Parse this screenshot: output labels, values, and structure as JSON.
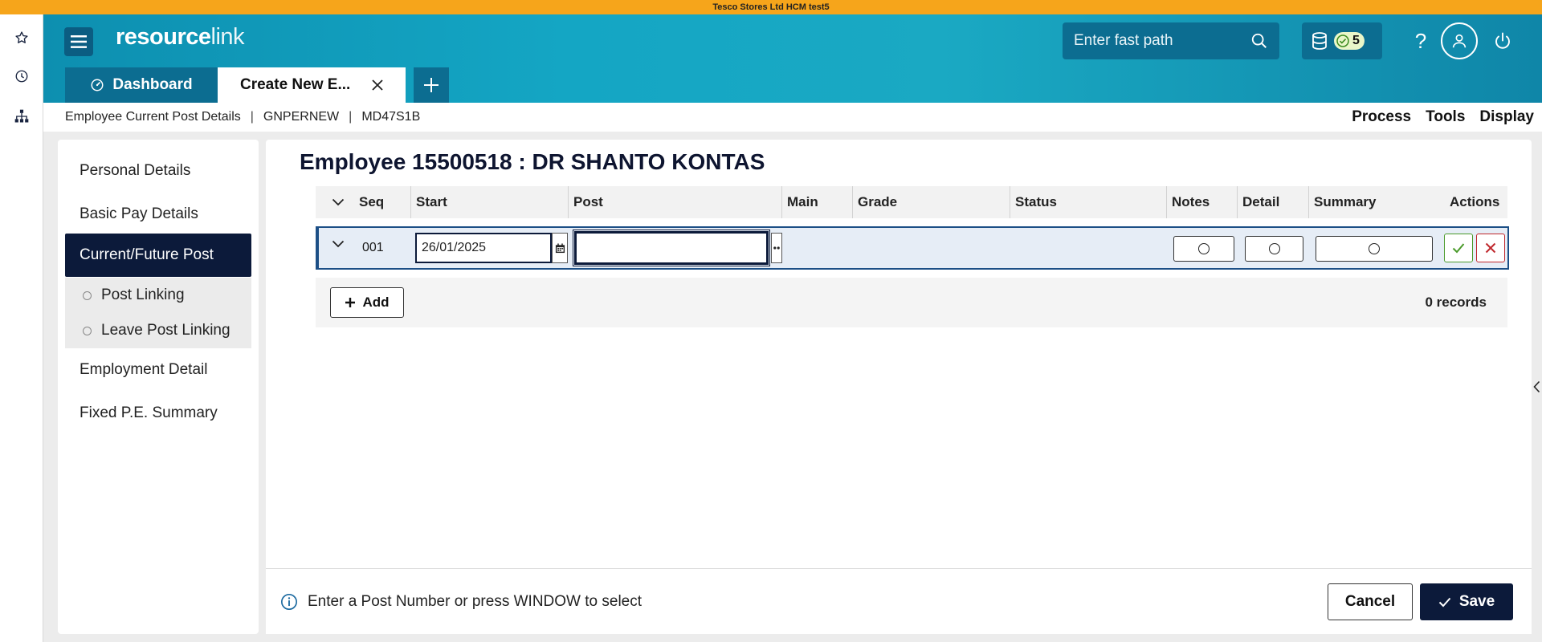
{
  "banner": {
    "text": "Tesco Stores Ltd HCM test5"
  },
  "rail": {
    "icons": [
      "star-icon",
      "clock-icon",
      "hierarchy-icon"
    ]
  },
  "header": {
    "logo_bold": "resource",
    "logo_light": "link",
    "fastpath_placeholder": "Enter fast path",
    "db_count": "5",
    "help_symbol": "?"
  },
  "tabs": {
    "dashboard": "Dashboard",
    "current": "Create New E..."
  },
  "breadcrumb": {
    "items": [
      "Employee Current Post Details",
      "GNPERNEW",
      "MD47S1B"
    ],
    "separator": "|"
  },
  "topmenu": {
    "process": "Process",
    "tools": "Tools",
    "display": "Display"
  },
  "nav": {
    "items": [
      {
        "label": "Personal Details"
      },
      {
        "label": "Basic Pay Details"
      },
      {
        "label": "Current/Future Post"
      },
      {
        "label": "Employment Detail"
      },
      {
        "label": "Fixed P.E. Summary"
      }
    ],
    "subitems": [
      {
        "label": "Post Linking"
      },
      {
        "label": "Leave Post Linking"
      }
    ]
  },
  "main": {
    "title": "Employee 15500518 : DR SHANTO KONTAS",
    "columns": {
      "seq": "Seq",
      "start": "Start",
      "post": "Post",
      "main": "Main",
      "grade": "Grade",
      "status": "Status",
      "notes": "Notes",
      "detail": "Detail",
      "summary": "Summary",
      "actions": "Actions"
    },
    "row": {
      "seq": "001",
      "start": "26/01/2025",
      "post": ""
    },
    "add_label": "Add",
    "records": "0 records",
    "message": "Enter a Post Number or press WINDOW to select",
    "cancel_label": "Cancel",
    "save_label": "Save"
  },
  "colors": {
    "accent_dark": "#0c1a3a",
    "header_teal": "#14a6c4",
    "banner_orange": "#f6a51b",
    "ok_green": "#4a9a2a",
    "cancel_red": "#c0282d"
  }
}
